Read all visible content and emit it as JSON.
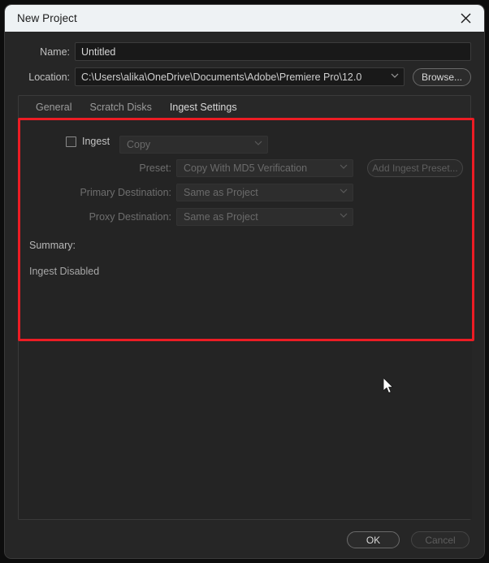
{
  "window": {
    "title": "New Project",
    "close_icon": "close-icon"
  },
  "form": {
    "name_label": "Name:",
    "name_value": "Untitled",
    "name_placeholder": "Untitled",
    "location_label": "Location:",
    "location_value": "C:\\Users\\alika\\OneDrive\\Documents\\Adobe\\Premiere Pro\\12.0",
    "browse_label": "Browse...",
    "chevron": "⌄"
  },
  "tabs": [
    {
      "label": "General",
      "active": false
    },
    {
      "label": "Scratch Disks",
      "active": false
    },
    {
      "label": "Ingest Settings",
      "active": true
    }
  ],
  "ingest": {
    "checkbox_label": "Ingest",
    "checkbox_checked": false,
    "mode_value": "Copy",
    "preset_label": "Preset:",
    "preset_value": "Copy With MD5 Verification",
    "add_preset_label": "Add Ingest Preset...",
    "primary_label": "Primary Destination:",
    "primary_value": "Same as Project",
    "proxy_label": "Proxy Destination:",
    "proxy_value": "Same as Project",
    "summary_label": "Summary:",
    "summary_value": "Ingest Disabled"
  },
  "footer": {
    "ok_label": "OK",
    "cancel_label": "Cancel"
  },
  "colors": {
    "accent_tab": "#2a7fd4",
    "highlight": "#ec1c24",
    "titlebar_bg": "#eef2f4",
    "dialog_bg": "#262626"
  }
}
